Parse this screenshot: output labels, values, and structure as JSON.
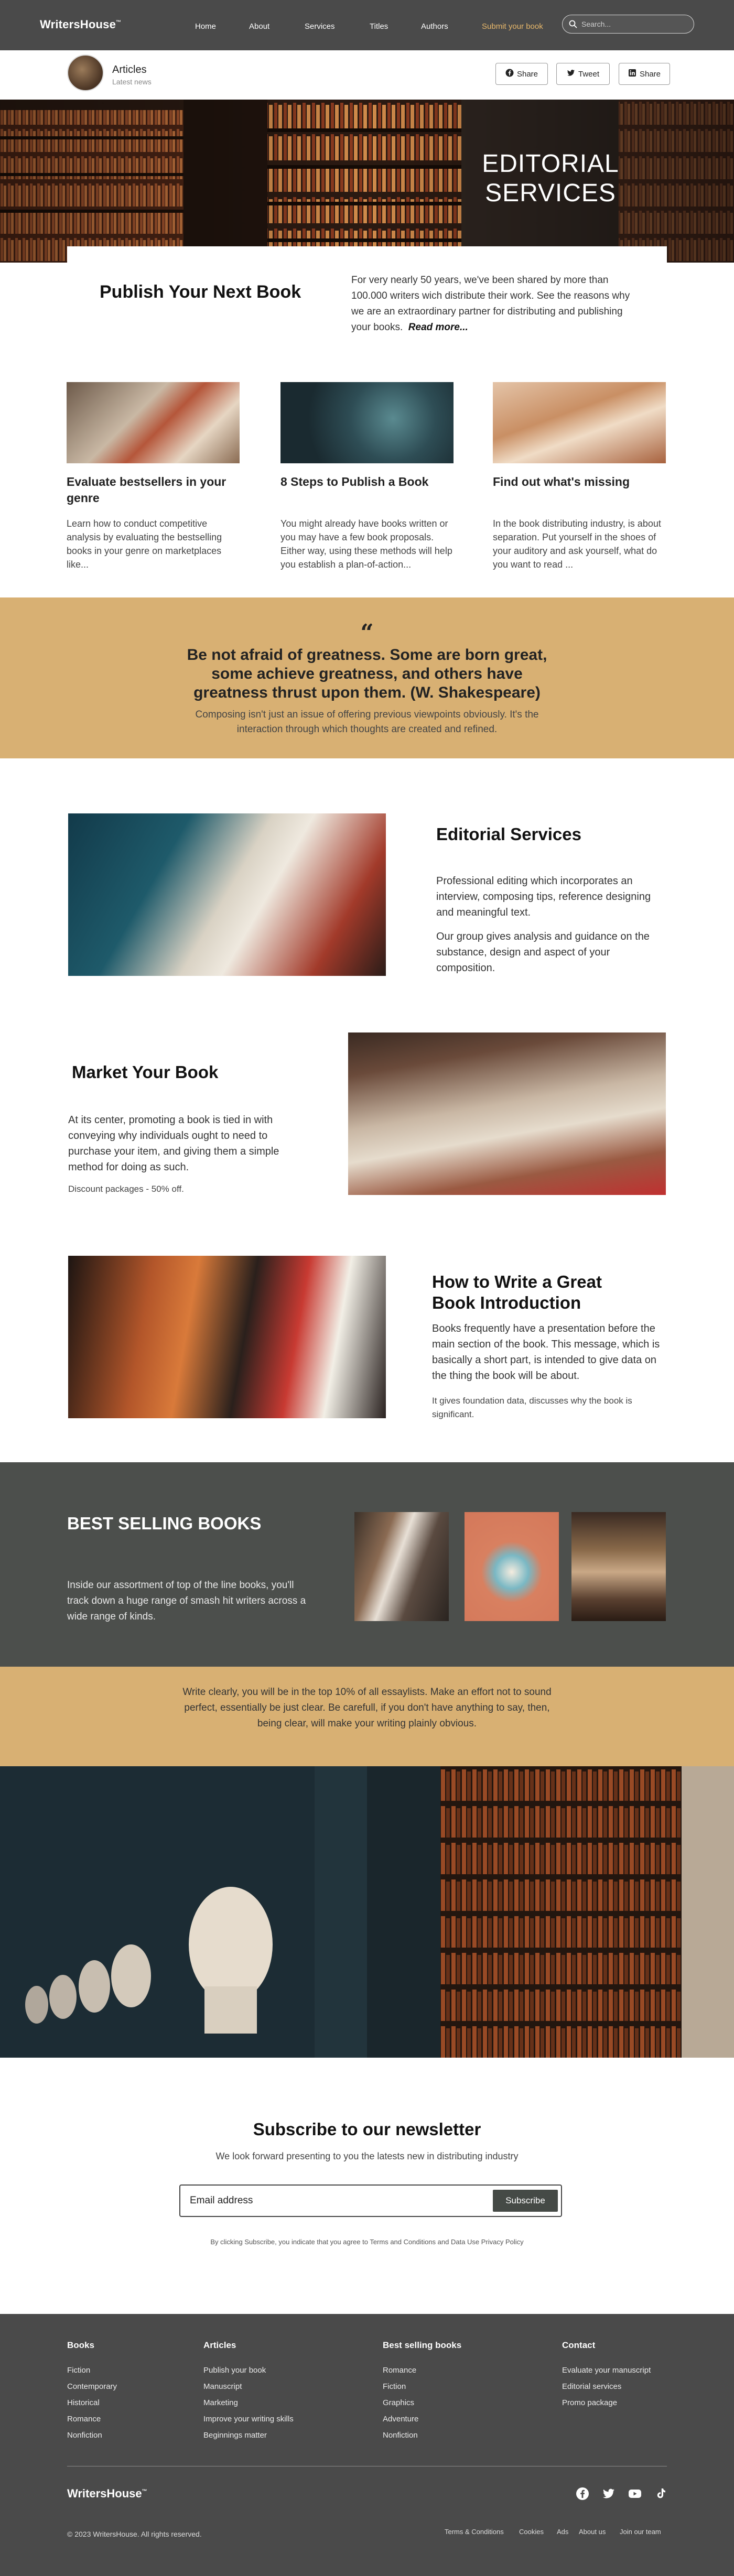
{
  "nav": {
    "brand": "WritersHouse",
    "brand_mark": "™",
    "links": [
      "Home",
      "About",
      "Services",
      "Titles",
      "Authors"
    ],
    "submit": "Submit your book",
    "search_placeholder": "Search...",
    "submit_color": "#e8b86b"
  },
  "article_bar": {
    "title": "Articles",
    "subtitle": "Latest news",
    "share_buttons": [
      "Share",
      "Tweet",
      "Share"
    ]
  },
  "hero": {
    "title": "EDITORIAL SERVICES"
  },
  "intro": {
    "heading": "Publish Your Next Book",
    "text": "For very nearly 50 years, we've been shared by more than 100.000 writers wich distribute their work. See the reasons why we are an extraordinary partner for distributing and publishing your books.",
    "read_more": "Read more..."
  },
  "cards": [
    {
      "title": "Evaluate bestsellers in your genre",
      "text": "Learn how to conduct competitive analysis by evaluating the bestselling books in your genre on marketplaces like..."
    },
    {
      "title": "8 Steps to Publish a Book",
      "text": "You might already have books written or you may have a few book proposals. Either way, using these methods will help you establish a plan-of-action..."
    },
    {
      "title": "Find out what's missing",
      "text": "In the book distributing industry, is about separation. Put yourself in the shoes of your auditory and ask yourself, what do you want to read ..."
    }
  ],
  "quote": {
    "mark": "“",
    "text": "Be not afraid of greatness. Some are born great, some achieve greatness, and others have greatness thrust upon them. (W. Shakespeare)",
    "sub": "Composing isn't just an issue of offering previous viewpoints obviously. It's the interaction through which thoughts are created and refined."
  },
  "features": {
    "editorial": {
      "title": "Editorial Services",
      "p1": "Professional editing which incorporates an interview, composing tips, reference designing and meaningful text.",
      "p2": "Our group gives analysis and guidance on the substance, design and aspect of your composition."
    },
    "market": {
      "title": "Market Your Book",
      "p1": "At its center, promoting a book is tied in with conveying why individuals ought to need to purchase your item, and giving them a simple method for doing as such.",
      "note": "Discount packages - 50% off."
    },
    "intro_book": {
      "title": "How to Write a Great Book Introduction",
      "p1": "Books frequently have a presentation before the main section of the book. This message, which is basically a short part, is intended to give data on the thing the book will be about.",
      "note": "It gives foundation data, discusses why the book is significant."
    }
  },
  "best_selling": {
    "title": "BEST SELLING BOOKS",
    "text": "Inside our assortment of top of the line books, you'll track down a huge range of smash hit writers across a wide range of kinds."
  },
  "note": {
    "text": "Write clearly, you will be in the top 10% of all essaylists. Make an effort not  to sound perfect, essentially be just clear. Be carefull, if you don't have anything to say, then, being clear, will make your writing  plainly obvious."
  },
  "newsletter": {
    "title": "Subscribe to our newsletter",
    "text": "We look forward presenting to you the latests new in distributing industry",
    "placeholder": "Email address",
    "button": "Subscribe",
    "legal": "By clicking Subscribe, you indicate that you agree to Terms and Conditions and Data Use Privacy Policy"
  },
  "footer": {
    "columns": [
      {
        "title": "Books",
        "items": [
          "Fiction",
          "Contemporary",
          "Historical",
          "Romance",
          "Nonfiction"
        ]
      },
      {
        "title": "Articles",
        "items": [
          "Publish your book",
          "Manuscript",
          "Marketing",
          "Improve your writing skills",
          "Beginnings matter"
        ]
      },
      {
        "title": "Best selling books",
        "items": [
          "Romance",
          "Fiction",
          "Graphics",
          "Adventure",
          "Nonfiction"
        ]
      },
      {
        "title": "Contact",
        "items": [
          "Evaluate your manuscript",
          "Editorial services",
          "Promo package"
        ]
      }
    ],
    "brand": "WritersHouse",
    "brand_mark": "™",
    "copyright": "© 2023 WritersHouse. All rights reserved.",
    "social_icons": [
      "facebook-icon",
      "twitter-icon",
      "youtube-icon",
      "tiktok-icon"
    ],
    "legal_links": [
      "Terms & Conditions",
      "Cookies",
      "Ads",
      "About us",
      "Join our team"
    ]
  },
  "colors": {
    "nav_bg": "#4a4a4a",
    "accent_sand": "#d8b073",
    "best_selling_bg": "#4c4f4c",
    "button_dark": "#454a46"
  }
}
